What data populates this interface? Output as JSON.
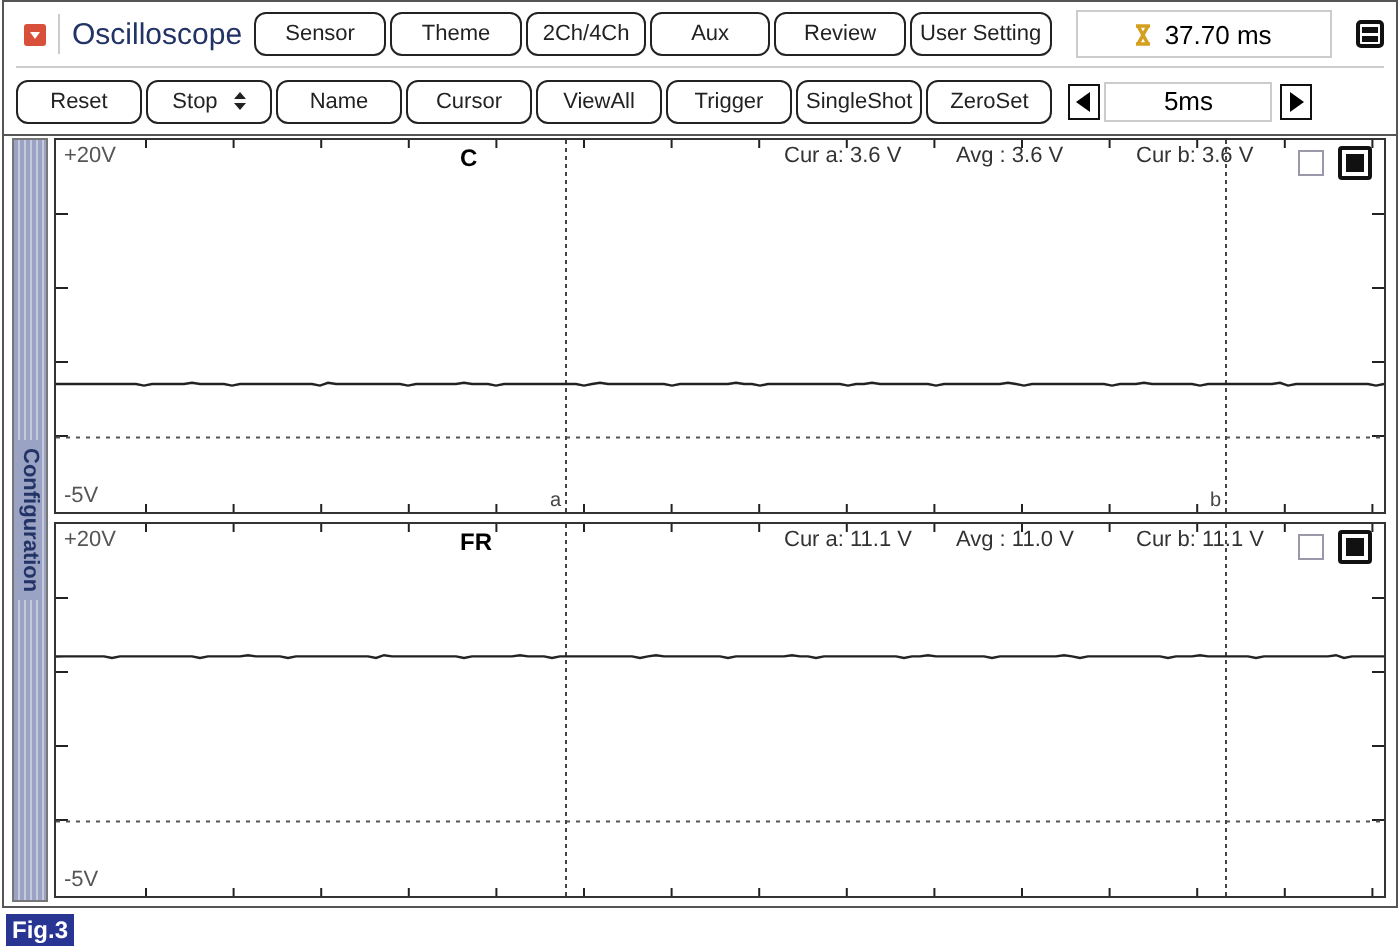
{
  "app": {
    "title": "Oscilloscope",
    "time_readout": "37.70 ms"
  },
  "top_buttons": [
    "Sensor",
    "Theme",
    "2Ch/4Ch",
    "Aux",
    "Review",
    "User Setting"
  ],
  "toolbar": [
    {
      "kind": "button",
      "label": "Reset"
    },
    {
      "kind": "select",
      "label": "Stop"
    },
    {
      "kind": "button",
      "label": "Name"
    },
    {
      "kind": "button",
      "label": "Cursor"
    },
    {
      "kind": "button",
      "label": "ViewAll"
    },
    {
      "kind": "button",
      "label": "Trigger"
    },
    {
      "kind": "button",
      "label": "SingleShot"
    },
    {
      "kind": "button",
      "label": "ZeroSet"
    }
  ],
  "timebase": {
    "value": "5ms"
  },
  "side_tab": "Configuration",
  "channels": [
    {
      "name": "C",
      "top": "+20V",
      "bottom": "-5V",
      "cur_a": "Cur a: 3.6 V",
      "avg": "Avg  : 3.6 V",
      "cur_b": "Cur b: 3.6 V",
      "checkbox_checked": false,
      "toggle_checked": true,
      "cursor_labels": [
        "a",
        "b"
      ]
    },
    {
      "name": "FR",
      "top": "+20V",
      "bottom": "-5V",
      "cur_a": "Cur a: 11.1 V",
      "avg": "Avg  : 11.0 V",
      "cur_b": "Cur b: 11.1 V",
      "checkbox_checked": false,
      "toggle_checked": true
    }
  ],
  "caption": "Fig.3"
}
